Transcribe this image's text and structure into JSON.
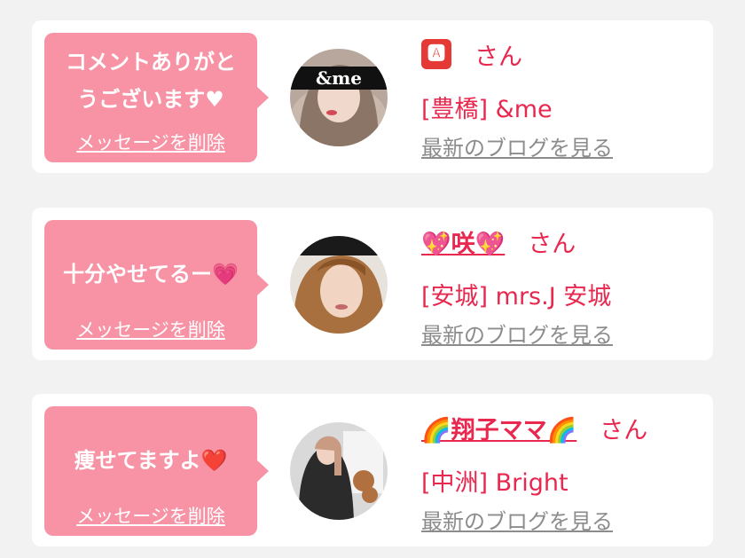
{
  "san_label": "さん",
  "delete_label": "メッセージを削除",
  "blog_label": "最新のブログを見る",
  "colors": {
    "bubble": "#f793a5",
    "accent": "#e8284f",
    "link_gray": "#8c8c8c",
    "background": "#f2f2f2"
  },
  "messages": [
    {
      "comment_line1": "コメントありがと",
      "comment_line2": "うございます♥",
      "name": "🅰",
      "store": "[豊橋] &me",
      "avatar_overlay_text": "&me"
    },
    {
      "comment": "十分やせてるー💗",
      "name": "💖咲💖",
      "store": "[安城] mrs.J 安城"
    },
    {
      "comment": "痩せてますよ❤️",
      "name": "🌈翔子ママ🌈",
      "store": "[中洲] Bright"
    }
  ]
}
